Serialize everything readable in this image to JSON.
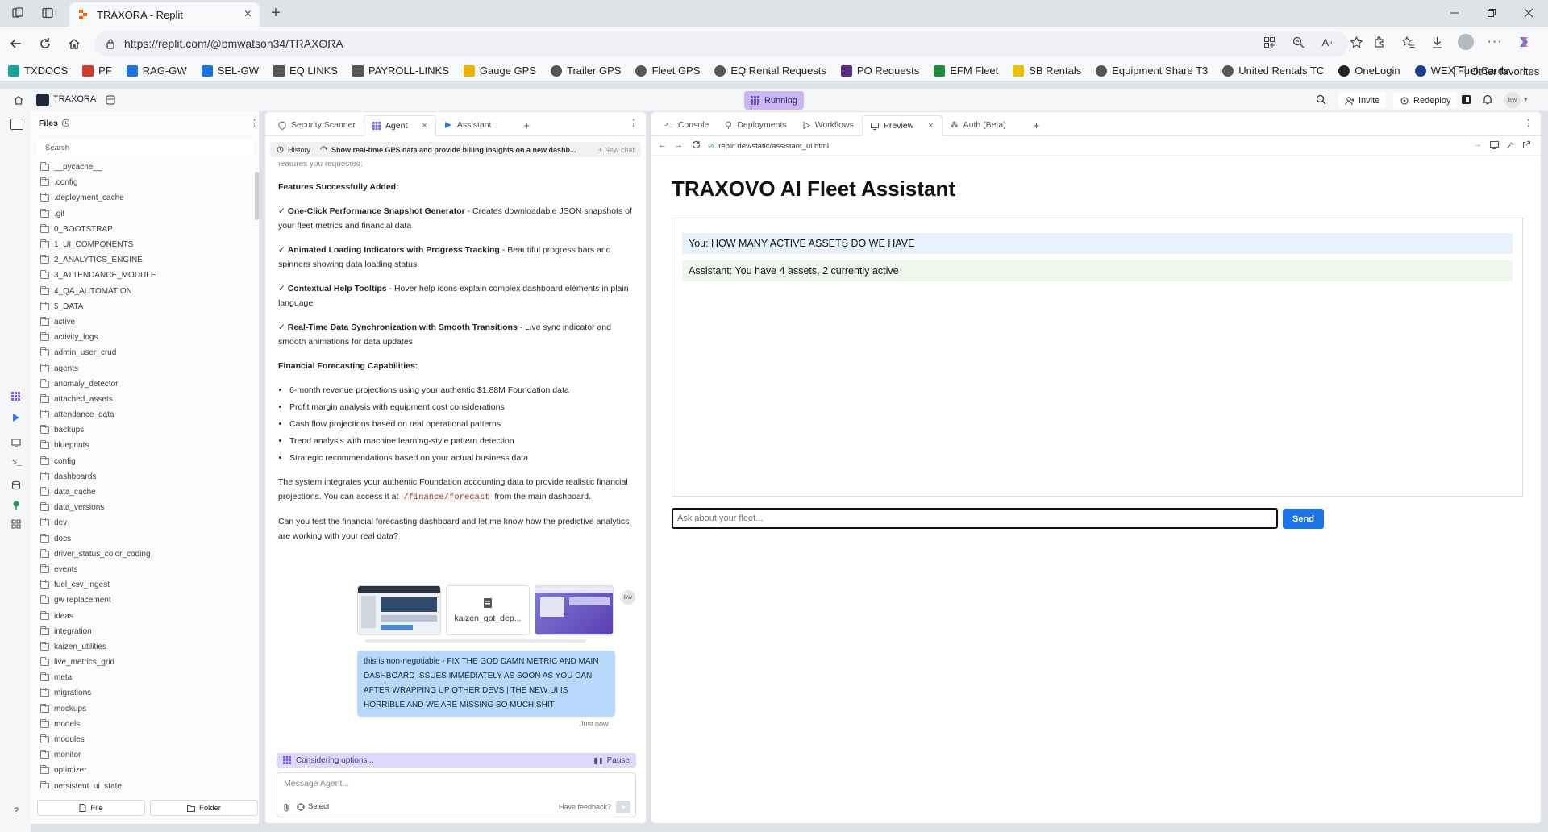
{
  "browser": {
    "tab_title": "TRAXORA - Replit",
    "url": "https://replit.com/@bmwatson34/TRAXORA",
    "favorites": [
      {
        "label": "TXDOCS",
        "color": "#1aa39b"
      },
      {
        "label": "PF",
        "color": "#d23b2c"
      },
      {
        "label": "RAG-GW",
        "color": "#1a73e8"
      },
      {
        "label": "SEL-GW",
        "color": "#1a73e8"
      },
      {
        "label": "EQ LINKS",
        "color": "#555555"
      },
      {
        "label": "PAYROLL-LINKS",
        "color": "#555555"
      },
      {
        "label": "Gauge GPS",
        "color": "#f0b400"
      },
      {
        "label": "Trailer GPS",
        "color": "#555555"
      },
      {
        "label": "Fleet GPS",
        "color": "#555555"
      },
      {
        "label": "EQ Rental Requests",
        "color": "#555555"
      },
      {
        "label": "PO Requests",
        "color": "#5a2d82"
      },
      {
        "label": "EFM Fleet",
        "color": "#1e8c3a"
      },
      {
        "label": "SB Rentals",
        "color": "#e5c100"
      },
      {
        "label": "Equipment Share T3",
        "color": "#555555"
      },
      {
        "label": "United Rentals TC",
        "color": "#555555"
      },
      {
        "label": "OneLogin",
        "color": "#222222"
      },
      {
        "label": "WEX Fuel Cards",
        "color": "#1a3d8f"
      }
    ],
    "other_favorites": "Other favorites"
  },
  "replit": {
    "project_name": "TRAXORA",
    "status": "Running",
    "invite_label": "Invite",
    "redeploy_label": "Redeploy",
    "avatar_initials": "BW"
  },
  "files": {
    "title": "Files",
    "search_placeholder": "Search",
    "items": [
      "__pycache__",
      ".config",
      ".deployment_cache",
      ".git",
      "0_BOOTSTRAP",
      "1_UI_COMPONENTS",
      "2_ANALYTICS_ENGINE",
      "3_ATTENDANCE_MODULE",
      "4_QA_AUTOMATION",
      "5_DATA",
      "active",
      "activity_logs",
      "admin_user_crud",
      "agents",
      "anomaly_detector",
      "attached_assets",
      "attendance_data",
      "backups",
      "blueprints",
      "config",
      "dashboards",
      "data_cache",
      "data_versions",
      "dev",
      "docs",
      "driver_status_color_coding",
      "events",
      "fuel_csv_ingest",
      "gw replacement",
      "ideas",
      "integration",
      "kaizen_utilities",
      "live_metrics_grid",
      "meta",
      "migrations",
      "mockups",
      "models",
      "modules",
      "monitor",
      "optimizer",
      "persistent_ui_state"
    ],
    "new_file_label": "File",
    "new_folder_label": "Folder"
  },
  "agent_panel": {
    "tabs": [
      "Security Scanner",
      "Agent",
      "Assistant"
    ],
    "history_label": "History",
    "thread_title": "Show real-time GPS data and provide billing insights on a new dashb...",
    "new_chat_label": "+ New chat",
    "truncated_top": "features you requested:",
    "features_heading": "Features Successfully Added:",
    "features": [
      {
        "title": "One-Click Performance Snapshot Generator",
        "desc": " - Creates downloadable JSON snapshots of your fleet metrics and financial data"
      },
      {
        "title": "Animated Loading Indicators with Progress Tracking",
        "desc": " - Beautiful progress bars and spinners showing data loading status"
      },
      {
        "title": "Contextual Help Tooltips",
        "desc": " - Hover help icons explain complex dashboard elements in plain language"
      },
      {
        "title": "Real-Time Data Synchronization with Smooth Transitions",
        "desc": " - Live sync indicator and smooth animations for data updates"
      }
    ],
    "forecast_heading": "Financial Forecasting Capabilities:",
    "forecast_items": [
      "6-month revenue projections using your authentic $1.88M Foundation data",
      "Profit margin analysis with equipment cost considerations",
      "Cash flow projections based on real operational patterns",
      "Trend analysis with machine learning-style pattern detection",
      "Strategic recommendations based on your actual business data"
    ],
    "integration_text_a": "The system integrates your authentic Foundation accounting data to provide realistic financial projections. You can access it at ",
    "integration_code": "/finance/forecast",
    "integration_text_b": " from the main dashboard.",
    "question": "Can you test the financial forecasting dashboard and let me know how the predictive analytics are working with your real data?",
    "attachment_name": "kaizen_gpt_dep...",
    "user_message": "this is non-negotiable - FIX THE GOD DAMN METRIC AND MAIN DASHBOARD ISSUES IMMEDIATELY AS SOON AS YOU CAN AFTER WRAPPING UP OTHER DEVS | THE NEW UI IS HORRIBLE AND WE ARE MISSING SO MUCH SHIT",
    "user_initials": "BW",
    "timestamp": "Just now",
    "status_text": "Considering options...",
    "pause_label": "Pause",
    "input_placeholder": "Message Agent...",
    "select_label": "Select",
    "feedback_label": "Have feedback?"
  },
  "preview_panel": {
    "tabs": [
      "Console",
      "Deployments",
      "Workflows",
      "Preview",
      "Auth (Beta)"
    ],
    "url": ".replit.dev/static/assistant_ui.html",
    "heading": "TRAXOVO AI Fleet Assistant",
    "messages": [
      {
        "text": "You: HOW MANY ACTIVE ASSETS DO WE HAVE",
        "bg": "#e8f2fd"
      },
      {
        "text": "Assistant: You have 4 assets, 2 currently active",
        "bg": "#eef7ea"
      }
    ],
    "input_placeholder": "Ask about your fleet...",
    "send_label": "Send",
    "send_color": "#1a73e8"
  }
}
